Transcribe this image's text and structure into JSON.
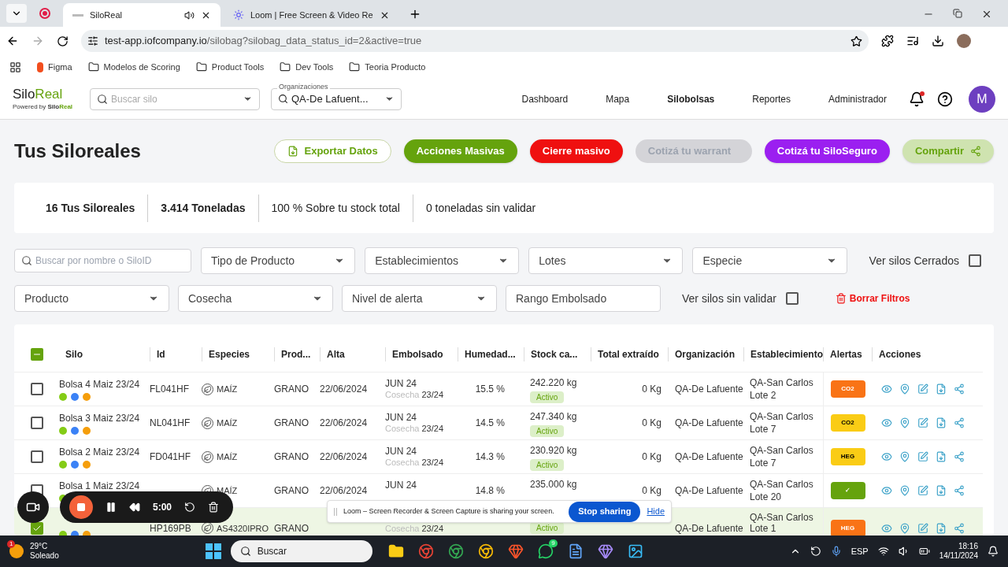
{
  "browser": {
    "tabs": [
      {
        "title": "SiloReal",
        "selected": true,
        "audio": true
      },
      {
        "title": "Loom | Free Screen & Video Re",
        "selected": false,
        "audio": false
      }
    ],
    "url_host": "test-app.iofcompany.io",
    "url_path": "/silobag?silobag_data_status_id=2&active=true",
    "bookmarks": [
      {
        "label": "Figma",
        "kind": "app"
      },
      {
        "label": "Modelos de Scoring",
        "kind": "folder"
      },
      {
        "label": "Product Tools",
        "kind": "folder"
      },
      {
        "label": "Dev Tools",
        "kind": "folder"
      },
      {
        "label": "Teoria Producto",
        "kind": "folder"
      }
    ]
  },
  "header": {
    "logo_a": "Silo",
    "logo_b": "Real",
    "powered": "Powered by",
    "powered_a": "Silo",
    "powered_b": "Real",
    "search_placeholder": "Buscar silo",
    "org_label": "Organizaciones",
    "org_value": "QA-De Lafuent...",
    "nav": [
      {
        "label": "Dashboard",
        "selected": false
      },
      {
        "label": "Mapa",
        "selected": false
      },
      {
        "label": "Silobolsas",
        "selected": true
      },
      {
        "label": "Reportes",
        "selected": false
      },
      {
        "label": "Administrador",
        "selected": false
      }
    ],
    "notification": true,
    "avatar": "M"
  },
  "title": "Tus Siloreales",
  "actions": [
    {
      "label": "Exportar Datos",
      "kind": "outline"
    },
    {
      "label": "Acciones Masivas",
      "kind": "green"
    },
    {
      "label": "Cierre masivo",
      "kind": "red"
    },
    {
      "label": "Cotizá tu warrant",
      "kind": "disabled"
    },
    {
      "label": "Cotizá tu SiloSeguro",
      "kind": "purple"
    },
    {
      "label": "Compartir",
      "kind": "share"
    }
  ],
  "summary": [
    {
      "text": "16 Tus Siloreales",
      "emphasis": true
    },
    {
      "text": "3.414 Toneladas",
      "emphasis": true
    },
    {
      "text": "100 % Sobre tu stock total",
      "emphasis": false
    },
    {
      "text": "0 toneladas sin validar",
      "emphasis": false
    }
  ],
  "filters_1": [
    {
      "kind": "search",
      "placeholder": "Buscar por nombre o SiloID"
    },
    {
      "kind": "select",
      "placeholder": "Tipo de Producto"
    },
    {
      "kind": "select",
      "placeholder": "Establecimientos"
    },
    {
      "kind": "select",
      "placeholder": "Lotes"
    },
    {
      "kind": "select",
      "placeholder": "Especie"
    },
    {
      "kind": "check",
      "label": "Ver silos Cerrados",
      "checked": false
    }
  ],
  "filters_2": [
    {
      "kind": "select",
      "placeholder": "Producto"
    },
    {
      "kind": "select",
      "placeholder": "Cosecha"
    },
    {
      "kind": "select",
      "placeholder": "Nivel de alerta"
    },
    {
      "kind": "text",
      "placeholder": "Rango Embolsado"
    },
    {
      "kind": "check",
      "label": "Ver silos sin validar",
      "checked": false
    },
    {
      "kind": "clear",
      "label": "Borrar Filtros"
    }
  ],
  "table": {
    "header_checkbox": {
      "indeterminate": true
    },
    "columns": [
      "Silo",
      "Id",
      "Especies",
      "Prod...",
      "Alta",
      "Embolsado",
      "Humedad...",
      "Stock ca...",
      "Total extraído",
      "Organización",
      "Establecimiento",
      "Alertas",
      "Acciones"
    ],
    "rows": [
      {
        "selected": false,
        "silo": "Bolsa 4 Maiz 23/24",
        "id": "FL041HF",
        "especie": "MAÍZ",
        "prod": "GRANO",
        "alta": "22/06/2024",
        "embolsado": "JUN 24",
        "cosecha_label": "Cosecha",
        "cosecha": "23/24",
        "humedad": "15.5 %",
        "stock": "242.220 kg",
        "status": "Activo",
        "total": "0 Kg",
        "org": "QA-De Lafuente",
        "est": "QA-San Carlos Lote 2",
        "alert": "CO2",
        "color": "#f97316"
      },
      {
        "selected": false,
        "silo": "Bolsa 3 Maiz 23/24",
        "id": "NL041HF",
        "especie": "MAÍZ",
        "prod": "GRANO",
        "alta": "22/06/2024",
        "embolsado": "JUN 24",
        "cosecha_label": "Cosecha",
        "cosecha": "23/24",
        "humedad": "14.5 %",
        "stock": "247.340 kg",
        "status": "Activo",
        "total": "0 Kg",
        "org": "QA-De Lafuente",
        "est": "QA-San Carlos Lote 7",
        "alert": "CO2",
        "color": "#facc15"
      },
      {
        "selected": false,
        "silo": "Bolsa 2 Maiz 23/24",
        "id": "FD041HF",
        "especie": "MAÍZ",
        "prod": "GRANO",
        "alta": "22/06/2024",
        "embolsado": "JUN 24",
        "cosecha_label": "Cosecha",
        "cosecha": "23/24",
        "humedad": "14.3 %",
        "stock": "230.920 kg",
        "status": "Activo",
        "total": "0 Kg",
        "org": "QA-De Lafuente",
        "est": "QA-San Carlos Lote 7",
        "alert": "HEG",
        "color": "#facc15"
      },
      {
        "selected": false,
        "silo": "Bolsa 1 Maiz 23/24",
        "especie": "MAÍZ",
        "prod": "GRANO",
        "alta": "22/06/2024",
        "embolsado": "JUN 24",
        "humedad": "14.8 %",
        "stock": "235.000 kg",
        "total": "0 Kg",
        "org": "QA-De Lafuente",
        "est": "QA-San Carlos Lote 20",
        "alert": "✓",
        "color": "#65a30d"
      },
      {
        "selected": true,
        "id": "HP169PB",
        "especie": "AS4320IPRO",
        "prod": "GRANO",
        "cosecha_label": "Cosecha",
        "cosecha": "23/24",
        "status": "Activo",
        "org": "QA-De Lafuente",
        "est": "QA-San Carlos Lote 1",
        "alert": "HEG",
        "color": "#f97316"
      }
    ]
  },
  "loom": {
    "time": "5:00",
    "message": "Loom – Screen Recorder & Screen Capture is sharing your screen.",
    "stop": "Stop sharing",
    "hide": "Hide"
  },
  "taskbar": {
    "weather_badge": "1",
    "temp": "29°C",
    "weather": "Soleado",
    "search": "Buscar",
    "chat_badge": "9",
    "lang": "ESP",
    "time": "18:16",
    "date": "14/11/2024"
  }
}
